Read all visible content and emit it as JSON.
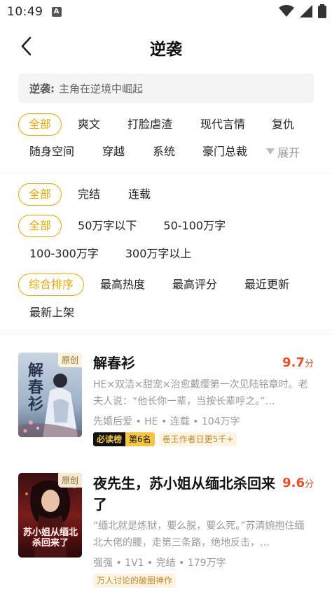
{
  "status": {
    "time": "10:49",
    "a_glyph": "A"
  },
  "header": {
    "title": "逆袭"
  },
  "description": {
    "key": "逆袭:",
    "text": "主角在逆境中崛起"
  },
  "genres": {
    "row1": [
      "全部",
      "爽文",
      "打脸虐渣",
      "现代言情",
      "复仇"
    ],
    "row2": [
      "随身空间",
      "穿越",
      "系统",
      "豪门总裁"
    ],
    "expand_label": "展开"
  },
  "status_filter": [
    "全部",
    "完结",
    "连载"
  ],
  "word_count_filter": {
    "row1": [
      "全部",
      "50万字以下",
      "50-100万字"
    ],
    "row2": [
      "100-300万字",
      "300万字以上"
    ]
  },
  "sort_filter": {
    "row1": [
      "综合排序",
      "最高热度",
      "最高评分",
      "最近更新"
    ],
    "row2": [
      "最新上架"
    ]
  },
  "colors": {
    "accent": "#f0a500",
    "score": "#f04e23"
  },
  "books": [
    {
      "badge": "原创",
      "cover_text": "解春衫",
      "title": "解春衫",
      "score": "9.7",
      "score_unit": "分",
      "desc": "HE×双洁×甜宠×治愈戴缨第一次见陆铭章时。老夫人说：“他长你一辈，当按长辈呼之。”…",
      "meta": "先婚后爱 • HE • 连载 • 104万字",
      "rank_label": "必读榜",
      "rank_pos": "第6名",
      "extra_tag": "卷王作者日更5千+"
    },
    {
      "badge": "原创",
      "cover_text": "苏小姐从缅北杀回来了",
      "title": "夜先生，苏小姐从缅北杀回来了",
      "score": "9.6",
      "score_unit": "分",
      "desc": "“缅北就是炼狱，要么脱，要么死。”苏清婉抱住缅北大佬的腰，走第三条路，绝地反击，…",
      "meta": "强强 • 1V1 • 完结 • 179万字",
      "extra_tag": "万人讨论的破圈神作"
    }
  ]
}
